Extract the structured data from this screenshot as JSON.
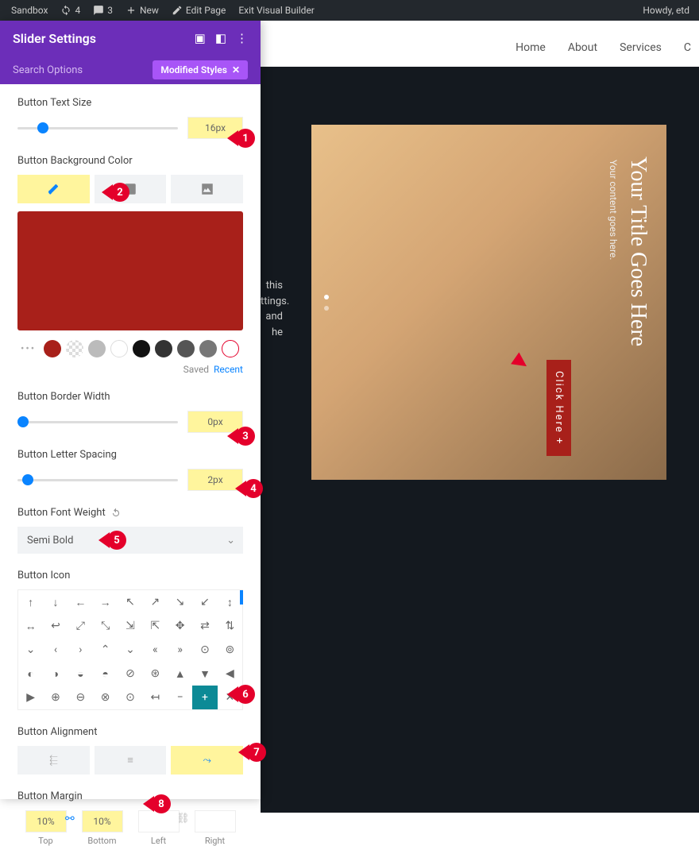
{
  "topbar": {
    "sandbox": "Sandbox",
    "updates": "4",
    "comments": "3",
    "new": "New",
    "edit": "Edit Page",
    "exit": "Exit Visual Builder",
    "greeting": "Howdy, etd"
  },
  "nav": {
    "home": "Home",
    "about": "About",
    "services": "Services",
    "c": "C"
  },
  "panel": {
    "title": "Slider Settings",
    "search": "Search Options",
    "badge": "Modified Styles"
  },
  "fields": {
    "text_size": {
      "label": "Button Text Size",
      "value": "16px"
    },
    "bg_color": {
      "label": "Button Background Color",
      "hex": "#a8201a",
      "saved": "Saved",
      "recent": "Recent"
    },
    "border_width": {
      "label": "Button Border Width",
      "value": "0px"
    },
    "letter_spacing": {
      "label": "Button Letter Spacing",
      "value": "2px"
    },
    "font_weight": {
      "label": "Button Font Weight",
      "value": "Semi Bold"
    },
    "icon": {
      "label": "Button Icon",
      "selected": "+"
    },
    "alignment": {
      "label": "Button Alignment"
    },
    "margin": {
      "label": "Button Margin",
      "top": "10%",
      "bottom": "10%",
      "left": "",
      "right": "",
      "lbl_top": "Top",
      "lbl_bottom": "Bottom",
      "lbl_left": "Left",
      "lbl_right": "Right"
    }
  },
  "slide": {
    "title": "Your Title Goes Here",
    "sub": "Your content goes here.",
    "btn": "Click Here +"
  },
  "callouts": {
    "1": "1",
    "2": "2",
    "3": "3",
    "4": "4",
    "5": "5",
    "6": "6",
    "7": "7",
    "8": "8"
  },
  "peek": "this ttings.\n and he"
}
